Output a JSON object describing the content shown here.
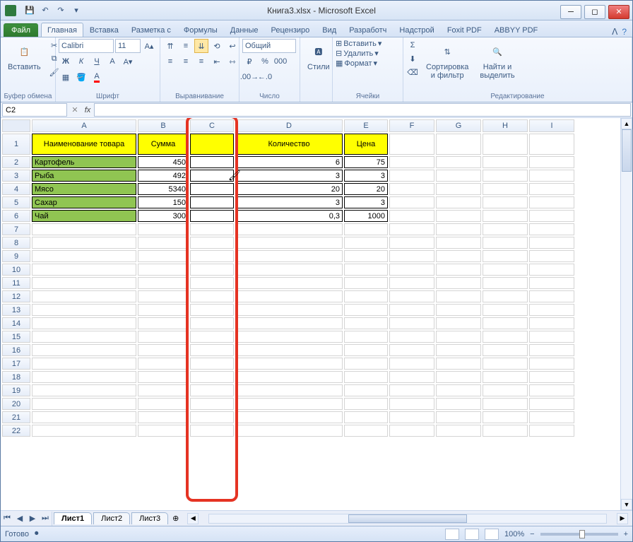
{
  "title": "Книга3.xlsx - Microsoft Excel",
  "tabs": {
    "file": "Файл",
    "items": [
      "Главная",
      "Вставка",
      "Разметка с",
      "Формулы",
      "Данные",
      "Рецензиро",
      "Вид",
      "Разработч",
      "Надстрой",
      "Foxit PDF",
      "ABBYY PDF"
    ],
    "active": 0
  },
  "ribbon": {
    "groups": {
      "clipboard": {
        "label": "Буфер обмена",
        "paste": "Вставить"
      },
      "font": {
        "label": "Шрифт",
        "name": "Calibri",
        "size": "11",
        "bold": "Ж",
        "italic": "К",
        "underline": "Ч"
      },
      "alignment": {
        "label": "Выравнивание"
      },
      "number": {
        "label": "Число",
        "format": "Общий"
      },
      "styles": {
        "label": "",
        "btn": "Стили"
      },
      "cells": {
        "label": "Ячейки",
        "insert": "Вставить",
        "delete": "Удалить",
        "format": "Формат"
      },
      "editing": {
        "label": "Редактирование",
        "sort": "Сортировка\nи фильтр",
        "find": "Найти и\nвыделить"
      }
    }
  },
  "namebox": "C2",
  "formula": "",
  "columns": [
    "A",
    "B",
    "C",
    "D",
    "E",
    "F",
    "G",
    "H",
    "I"
  ],
  "rows": 22,
  "headers": {
    "A": "Наименование товара",
    "B": "Сумма",
    "C": "",
    "D": "Количество",
    "E": "Цена"
  },
  "data": [
    {
      "A": "Картофель",
      "B": "450",
      "D": "6",
      "E": "75"
    },
    {
      "A": "Рыба",
      "B": "492",
      "D": "3",
      "E": "3"
    },
    {
      "A": "Мясо",
      "B": "5340",
      "D": "20",
      "E": "20"
    },
    {
      "A": "Сахар",
      "B": "150",
      "D": "3",
      "E": "3"
    },
    {
      "A": "Чай",
      "B": "300",
      "D": "0,3",
      "E": "1000"
    }
  ],
  "sheet_tabs": [
    "Лист1",
    "Лист2",
    "Лист3"
  ],
  "active_sheet": 0,
  "status": "Готово",
  "zoom": "100%"
}
